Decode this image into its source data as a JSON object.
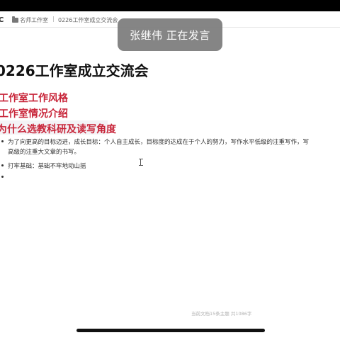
{
  "breadcrumb": {
    "back_glyph": "C",
    "folder_icon": "folder-icon",
    "item1": "名师工作室",
    "separator": "|",
    "item2": "0226工作室成立交流会"
  },
  "toast": {
    "text": "张继伟 正在发言"
  },
  "document": {
    "title": "0226工作室成立交流会",
    "headings": [
      "工作室工作风格",
      "工作室情况介绍",
      "为什么选教科研及读写角度"
    ],
    "bullets": [
      {
        "line1": "为了向更高的目标迈进，成长目标：个人自主成长，目标度的达成在于个人的努力，写作水平低级的注重写作，写",
        "line2": "高级的注重大文章的书写。"
      },
      {
        "line1": "打牢基础：基础不牢地动山摇"
      },
      {
        "line1": ""
      }
    ],
    "stats": "当前文档15条主题 共1086字"
  },
  "colors": {
    "heading": "#c8263a",
    "toast_bg": "#787878",
    "text": "#333333"
  }
}
